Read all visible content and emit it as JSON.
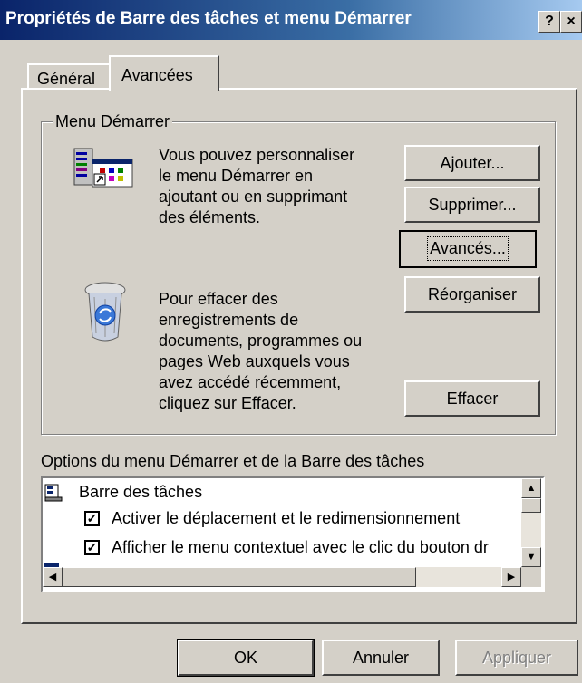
{
  "window": {
    "title": "Propriétés de Barre des tâches et menu Démarrer",
    "help_button": "?",
    "close_button": "×"
  },
  "tabs": [
    {
      "label": "Général",
      "selected": false
    },
    {
      "label": "Avancées",
      "selected": true
    }
  ],
  "start_menu_group": {
    "label": "Menu Démarrer",
    "customize_text": [
      "Vous pouvez personnaliser",
      "le menu Démarrer en",
      "ajoutant ou en supprimant",
      "des éléments."
    ],
    "clear_text": [
      "Pour effacer des",
      "enregistrements de",
      "documents, programmes ou",
      "pages Web auxquels vous",
      "avez accédé récemment,",
      "cliquez sur Effacer."
    ],
    "buttons": {
      "add": "Ajouter...",
      "remove": "Supprimer...",
      "advanced": "Avancés...",
      "sort": "Réorganiser",
      "clear": "Effacer"
    },
    "icons": {
      "start_menu": "start-menu-icon",
      "recycle": "recycle-bin-icon"
    }
  },
  "options": {
    "label": "Options du menu Démarrer et de la Barre des tâches",
    "items": [
      {
        "type": "header",
        "text": "Barre des tâches",
        "icon": "taskbar-icon"
      },
      {
        "type": "checkbox",
        "text": "Activer le déplacement et le redimensionnement",
        "checked": true
      },
      {
        "type": "checkbox",
        "text": "Afficher le menu contextuel avec le clic du bouton dr",
        "checked": true
      }
    ]
  },
  "dialog_buttons": {
    "ok": "OK",
    "cancel": "Annuler",
    "apply": "Appliquer"
  }
}
